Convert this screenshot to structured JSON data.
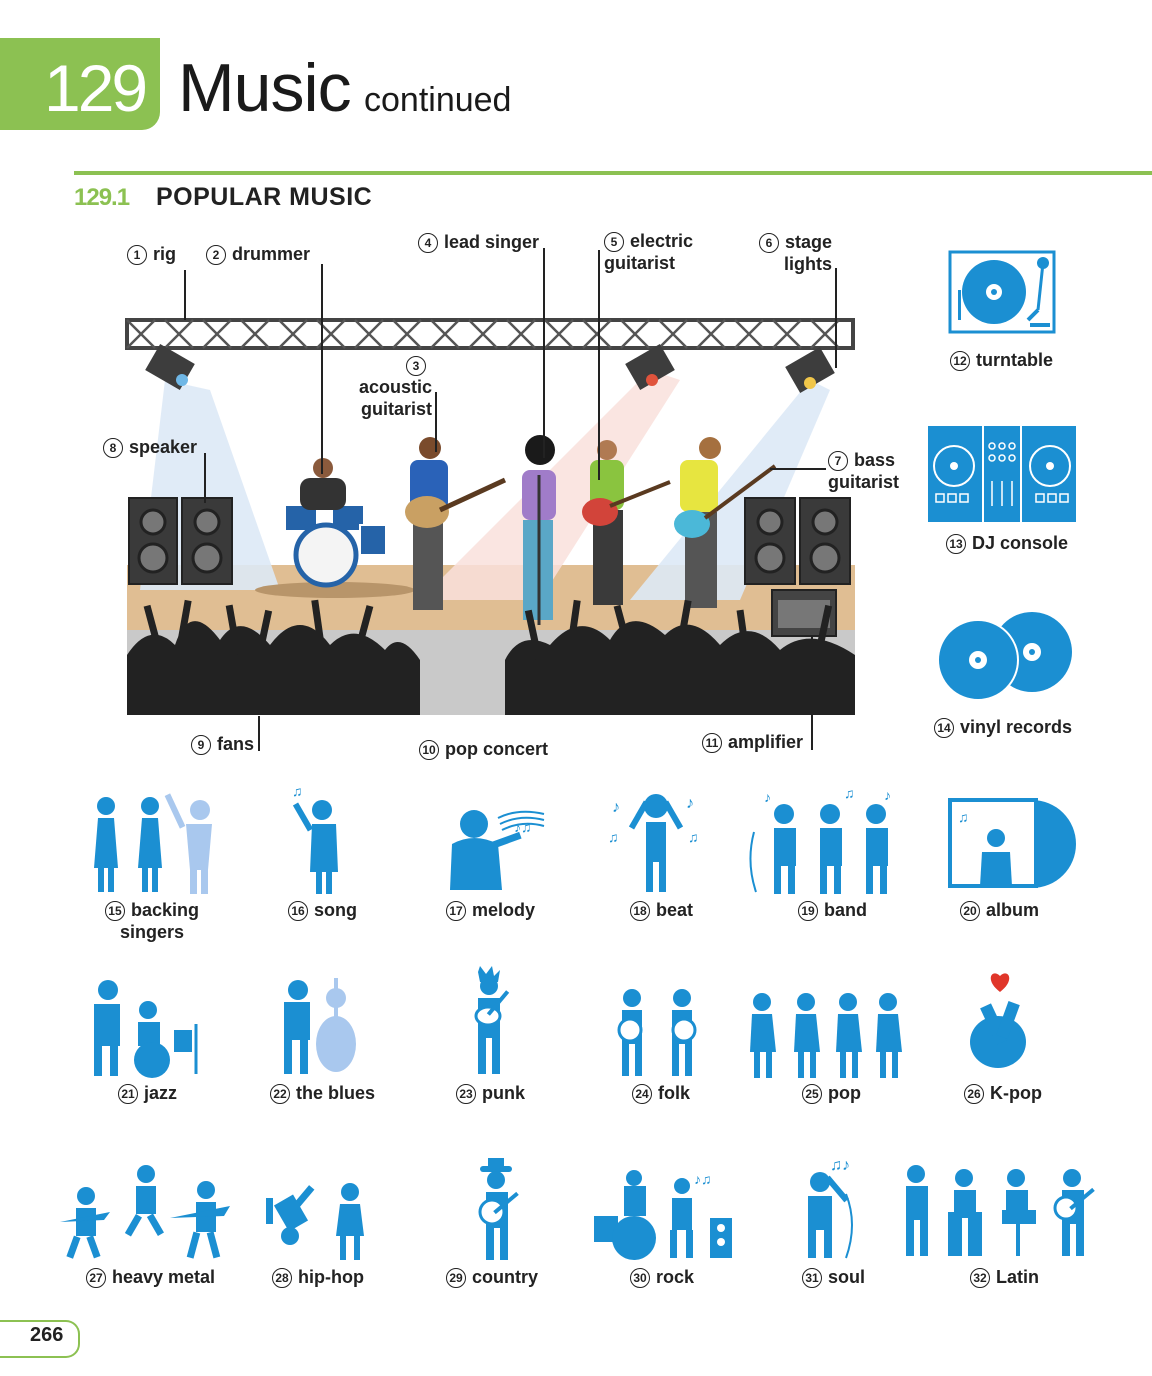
{
  "header": {
    "chapter_number": "129",
    "chapter_title": "Music",
    "chapter_subtitle": "continued"
  },
  "section": {
    "number": "129.1",
    "title": "POPULAR MUSIC"
  },
  "labels": [
    {
      "n": "1",
      "text": "rig"
    },
    {
      "n": "2",
      "text": "drummer"
    },
    {
      "n": "3",
      "text": "acoustic\nguitarist"
    },
    {
      "n": "4",
      "text": "lead singer"
    },
    {
      "n": "5",
      "text": "electric\nguitarist"
    },
    {
      "n": "6",
      "text": "stage\nlights"
    },
    {
      "n": "7",
      "text": "bass\nguitarist"
    },
    {
      "n": "8",
      "text": "speaker"
    },
    {
      "n": "9",
      "text": "fans"
    },
    {
      "n": "10",
      "text": "pop concert"
    },
    {
      "n": "11",
      "text": "amplifier"
    },
    {
      "n": "12",
      "text": "turntable"
    },
    {
      "n": "13",
      "text": "DJ console"
    },
    {
      "n": "14",
      "text": "vinyl records"
    },
    {
      "n": "15",
      "text": "backing\nsingers"
    },
    {
      "n": "16",
      "text": "song"
    },
    {
      "n": "17",
      "text": "melody"
    },
    {
      "n": "18",
      "text": "beat"
    },
    {
      "n": "19",
      "text": "band"
    },
    {
      "n": "20",
      "text": "album"
    },
    {
      "n": "21",
      "text": "jazz"
    },
    {
      "n": "22",
      "text": "the blues"
    },
    {
      "n": "23",
      "text": "punk"
    },
    {
      "n": "24",
      "text": "folk"
    },
    {
      "n": "25",
      "text": "pop"
    },
    {
      "n": "26",
      "text": "K-pop"
    },
    {
      "n": "27",
      "text": "heavy metal"
    },
    {
      "n": "28",
      "text": "hip-hop"
    },
    {
      "n": "29",
      "text": "country"
    },
    {
      "n": "30",
      "text": "rock"
    },
    {
      "n": "31",
      "text": "soul"
    },
    {
      "n": "32",
      "text": "Latin"
    }
  ],
  "page_number": "266",
  "colors": {
    "accent_green": "#8cc152",
    "icon_blue": "#1b8fd2",
    "icon_light_blue": "#a9c8ee"
  }
}
